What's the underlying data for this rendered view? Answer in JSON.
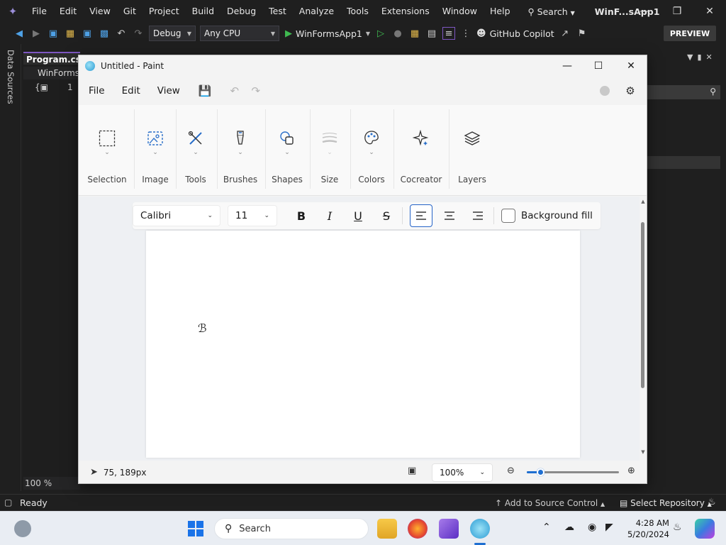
{
  "vs": {
    "menu": [
      "File",
      "Edit",
      "View",
      "Git",
      "Project",
      "Build",
      "Debug",
      "Test",
      "Analyze",
      "Tools",
      "Extensions",
      "Window",
      "Help"
    ],
    "search_label": "Search",
    "solution_name": "WinF...sApp1",
    "toolbar": {
      "config": "Debug",
      "platform": "Any CPU",
      "run_target": "WinFormsApp1",
      "copilot": "GitHub Copilot",
      "preview": "PREVIEW"
    },
    "rail_label": "Data Sources",
    "doc_tab": "Program.cs*",
    "nav_project": "WinForms",
    "line_number": "1",
    "zoom": "100 %",
    "status": {
      "ready": "Ready",
      "add_source": "Add to Source Control",
      "select_repo": "Select Repository"
    }
  },
  "paint": {
    "title": "Untitled - Paint",
    "menu": [
      "File",
      "Edit",
      "View"
    ],
    "ribbon": [
      {
        "label": "Selection",
        "icon": "selection-icon"
      },
      {
        "label": "Image",
        "icon": "image-icon"
      },
      {
        "label": "Tools",
        "icon": "tools-icon"
      },
      {
        "label": "Brushes",
        "icon": "brush-icon"
      },
      {
        "label": "Shapes",
        "icon": "shapes-icon"
      },
      {
        "label": "Size",
        "icon": "size-icon"
      },
      {
        "label": "Colors",
        "icon": "palette-icon"
      },
      {
        "label": "Cocreator",
        "icon": "cocreator-icon"
      },
      {
        "label": "Layers",
        "icon": "layers-icon"
      }
    ],
    "text_toolbar": {
      "font": "Calibri",
      "size": "11",
      "background_fill": "Background fill"
    },
    "status": {
      "coords": "75, 189px",
      "zoom": "100%",
      "zoom_level": 0.15
    }
  },
  "taskbar": {
    "search": "Search",
    "time": "4:28 AM",
    "date": "5/20/2024"
  },
  "colors": {
    "vs_bg": "#1f1f1f",
    "accent": "#1f6fd1",
    "paint_bg": "#f3f3f3"
  }
}
